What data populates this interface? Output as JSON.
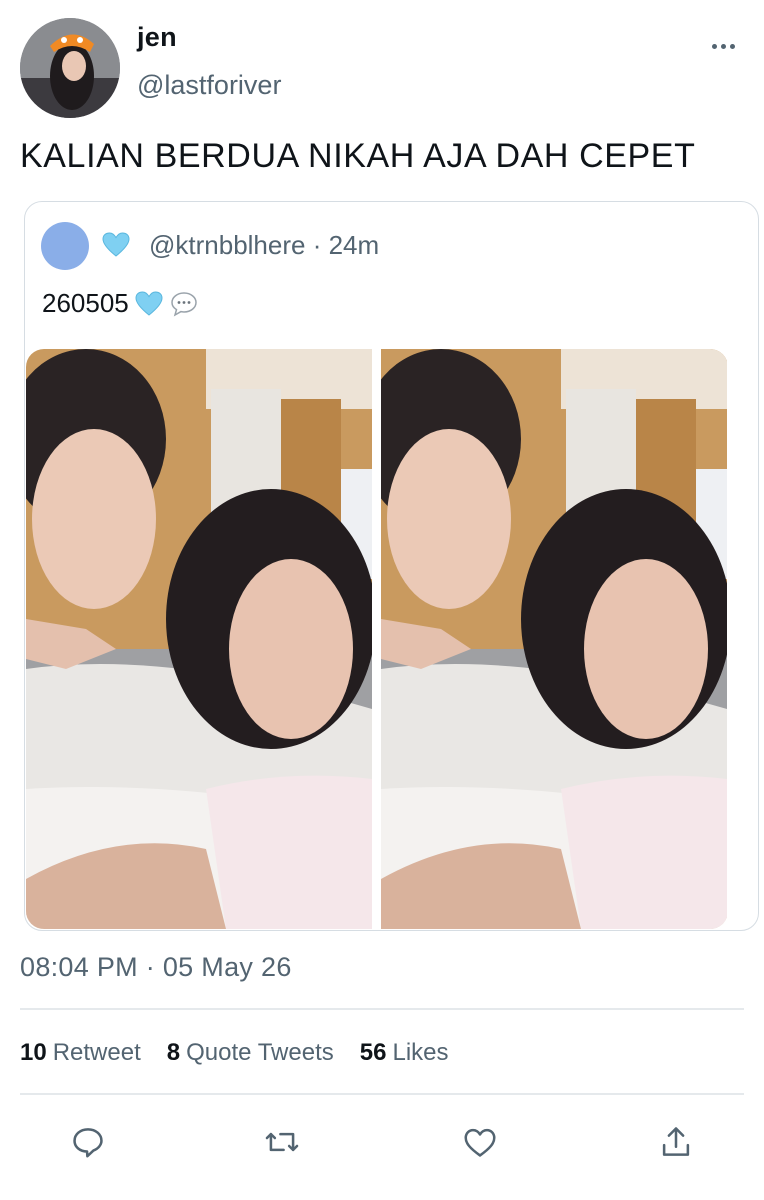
{
  "author": {
    "display_name": "jen",
    "handle": "@lastforiver"
  },
  "tweet": {
    "text": "KALIAN BERDUA NIKAH AJA DAH CEPET",
    "timestamp": "08:04 PM · 05 May 26"
  },
  "quoted_tweet": {
    "handle_time": "@ktrnbblhere · 24m",
    "text": "260505",
    "emoji": [
      "light-blue-heart",
      "speech-bubble"
    ]
  },
  "stats": {
    "retweets_count": "10",
    "retweets_label": "Retweet",
    "quotes_count": "8",
    "quotes_label": "Quote Tweets",
    "likes_count": "56",
    "likes_label": "Likes"
  },
  "actions": [
    "reply-icon",
    "retweet-icon",
    "like-icon",
    "share-icon"
  ],
  "colors": {
    "text_primary": "#0f1419",
    "text_secondary": "#536471",
    "border": "#d6dde3",
    "heart_emoji": "#7fd0f2",
    "quoted_avatar": "#8aaee8"
  }
}
